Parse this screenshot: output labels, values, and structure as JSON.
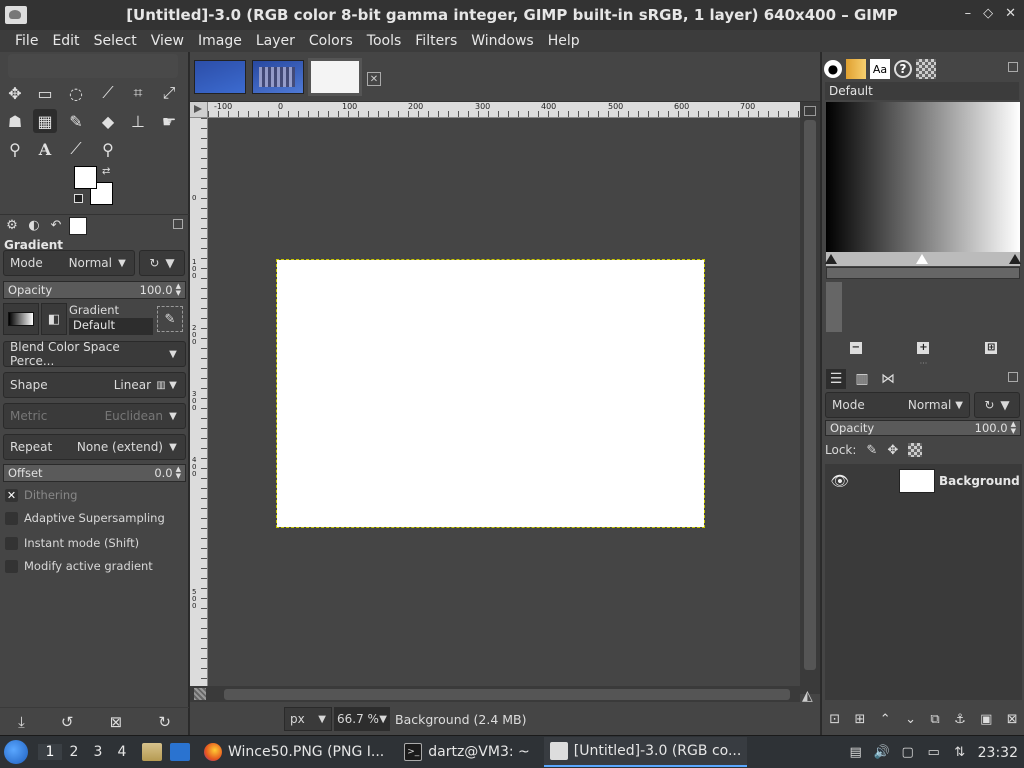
{
  "window": {
    "title": "[Untitled]-3.0 (RGB color 8-bit gamma integer, GIMP built-in sRGB, 1 layer) 640x400 – GIMP",
    "buttons": [
      "–",
      "◇",
      "✕"
    ]
  },
  "menubar": [
    "File",
    "Edit",
    "Select",
    "View",
    "Image",
    "Layer",
    "Colors",
    "Tools",
    "Filters",
    "Windows",
    "Help"
  ],
  "tool_options": {
    "title": "Gradient",
    "mode_label": "Mode",
    "mode_value": "Normal",
    "opacity_label": "Opacity",
    "opacity_value": "100.0",
    "gradient_label": "Gradient",
    "gradient_value": "Default",
    "blend_color_space": "Blend Color Space Perce...",
    "shape_label": "Shape",
    "shape_value": "Linear",
    "metric_label": "Metric",
    "metric_value": "Euclidean",
    "repeat_label": "Repeat",
    "repeat_value": "None (extend)",
    "offset_label": "Offset",
    "offset_value": "0.0",
    "checks": [
      {
        "label": "Dithering",
        "checked": true,
        "dim": true
      },
      {
        "label": "Adaptive Supersampling",
        "checked": false,
        "dim": false
      },
      {
        "label": "Instant mode  (Shift)",
        "checked": false,
        "dim": false
      },
      {
        "label": "Modify active gradient",
        "checked": false,
        "dim": false
      }
    ]
  },
  "ruler_top": [
    "-100",
    "0",
    "100",
    "200",
    "300",
    "400",
    "500",
    "600",
    "700"
  ],
  "ruler_left": [
    "0",
    "1",
    "0",
    "0",
    "2",
    "0",
    "0",
    "3",
    "0",
    "0",
    "4",
    "0",
    "0",
    "5",
    "0",
    "0"
  ],
  "statusbar": {
    "unit": "px",
    "zoom": "66.7 %",
    "info": "Background (2.4 MB)"
  },
  "gradients_panel": {
    "header": "Default"
  },
  "layers_panel": {
    "mode_label": "Mode",
    "mode_value": "Normal",
    "opacity_label": "Opacity",
    "opacity_value": "100.0",
    "lock_label": "Lock:",
    "layers": [
      {
        "name": "Background"
      }
    ]
  },
  "taskbar": {
    "workspaces": [
      "1",
      "2",
      "3",
      "4"
    ],
    "tasks": [
      {
        "label": "Wince50.PNG (PNG I...",
        "icon": "firefox-icon"
      },
      {
        "label": "dartz@VM3: ~",
        "icon": "terminal-icon"
      },
      {
        "label": "[Untitled]-3.0 (RGB co...",
        "icon": "gimp-icon"
      }
    ],
    "clock": "23:32"
  }
}
